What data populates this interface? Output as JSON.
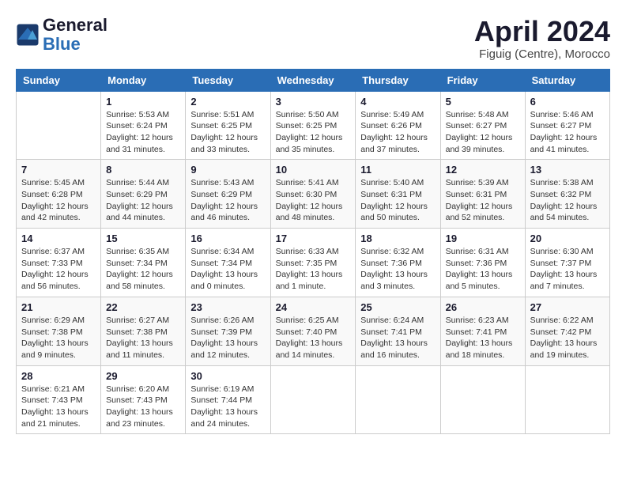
{
  "logo": {
    "line1": "General",
    "line2": "Blue"
  },
  "title": "April 2024",
  "subtitle": "Figuig (Centre), Morocco",
  "days_header": [
    "Sunday",
    "Monday",
    "Tuesday",
    "Wednesday",
    "Thursday",
    "Friday",
    "Saturday"
  ],
  "weeks": [
    [
      {
        "day": "",
        "info": ""
      },
      {
        "day": "1",
        "info": "Sunrise: 5:53 AM\nSunset: 6:24 PM\nDaylight: 12 hours\nand 31 minutes."
      },
      {
        "day": "2",
        "info": "Sunrise: 5:51 AM\nSunset: 6:25 PM\nDaylight: 12 hours\nand 33 minutes."
      },
      {
        "day": "3",
        "info": "Sunrise: 5:50 AM\nSunset: 6:25 PM\nDaylight: 12 hours\nand 35 minutes."
      },
      {
        "day": "4",
        "info": "Sunrise: 5:49 AM\nSunset: 6:26 PM\nDaylight: 12 hours\nand 37 minutes."
      },
      {
        "day": "5",
        "info": "Sunrise: 5:48 AM\nSunset: 6:27 PM\nDaylight: 12 hours\nand 39 minutes."
      },
      {
        "day": "6",
        "info": "Sunrise: 5:46 AM\nSunset: 6:27 PM\nDaylight: 12 hours\nand 41 minutes."
      }
    ],
    [
      {
        "day": "7",
        "info": "Sunrise: 5:45 AM\nSunset: 6:28 PM\nDaylight: 12 hours\nand 42 minutes."
      },
      {
        "day": "8",
        "info": "Sunrise: 5:44 AM\nSunset: 6:29 PM\nDaylight: 12 hours\nand 44 minutes."
      },
      {
        "day": "9",
        "info": "Sunrise: 5:43 AM\nSunset: 6:29 PM\nDaylight: 12 hours\nand 46 minutes."
      },
      {
        "day": "10",
        "info": "Sunrise: 5:41 AM\nSunset: 6:30 PM\nDaylight: 12 hours\nand 48 minutes."
      },
      {
        "day": "11",
        "info": "Sunrise: 5:40 AM\nSunset: 6:31 PM\nDaylight: 12 hours\nand 50 minutes."
      },
      {
        "day": "12",
        "info": "Sunrise: 5:39 AM\nSunset: 6:31 PM\nDaylight: 12 hours\nand 52 minutes."
      },
      {
        "day": "13",
        "info": "Sunrise: 5:38 AM\nSunset: 6:32 PM\nDaylight: 12 hours\nand 54 minutes."
      }
    ],
    [
      {
        "day": "14",
        "info": "Sunrise: 6:37 AM\nSunset: 7:33 PM\nDaylight: 12 hours\nand 56 minutes."
      },
      {
        "day": "15",
        "info": "Sunrise: 6:35 AM\nSunset: 7:34 PM\nDaylight: 12 hours\nand 58 minutes."
      },
      {
        "day": "16",
        "info": "Sunrise: 6:34 AM\nSunset: 7:34 PM\nDaylight: 13 hours\nand 0 minutes."
      },
      {
        "day": "17",
        "info": "Sunrise: 6:33 AM\nSunset: 7:35 PM\nDaylight: 13 hours\nand 1 minute."
      },
      {
        "day": "18",
        "info": "Sunrise: 6:32 AM\nSunset: 7:36 PM\nDaylight: 13 hours\nand 3 minutes."
      },
      {
        "day": "19",
        "info": "Sunrise: 6:31 AM\nSunset: 7:36 PM\nDaylight: 13 hours\nand 5 minutes."
      },
      {
        "day": "20",
        "info": "Sunrise: 6:30 AM\nSunset: 7:37 PM\nDaylight: 13 hours\nand 7 minutes."
      }
    ],
    [
      {
        "day": "21",
        "info": "Sunrise: 6:29 AM\nSunset: 7:38 PM\nDaylight: 13 hours\nand 9 minutes."
      },
      {
        "day": "22",
        "info": "Sunrise: 6:27 AM\nSunset: 7:38 PM\nDaylight: 13 hours\nand 11 minutes."
      },
      {
        "day": "23",
        "info": "Sunrise: 6:26 AM\nSunset: 7:39 PM\nDaylight: 13 hours\nand 12 minutes."
      },
      {
        "day": "24",
        "info": "Sunrise: 6:25 AM\nSunset: 7:40 PM\nDaylight: 13 hours\nand 14 minutes."
      },
      {
        "day": "25",
        "info": "Sunrise: 6:24 AM\nSunset: 7:41 PM\nDaylight: 13 hours\nand 16 minutes."
      },
      {
        "day": "26",
        "info": "Sunrise: 6:23 AM\nSunset: 7:41 PM\nDaylight: 13 hours\nand 18 minutes."
      },
      {
        "day": "27",
        "info": "Sunrise: 6:22 AM\nSunset: 7:42 PM\nDaylight: 13 hours\nand 19 minutes."
      }
    ],
    [
      {
        "day": "28",
        "info": "Sunrise: 6:21 AM\nSunset: 7:43 PM\nDaylight: 13 hours\nand 21 minutes."
      },
      {
        "day": "29",
        "info": "Sunrise: 6:20 AM\nSunset: 7:43 PM\nDaylight: 13 hours\nand 23 minutes."
      },
      {
        "day": "30",
        "info": "Sunrise: 6:19 AM\nSunset: 7:44 PM\nDaylight: 13 hours\nand 24 minutes."
      },
      {
        "day": "",
        "info": ""
      },
      {
        "day": "",
        "info": ""
      },
      {
        "day": "",
        "info": ""
      },
      {
        "day": "",
        "info": ""
      }
    ]
  ]
}
